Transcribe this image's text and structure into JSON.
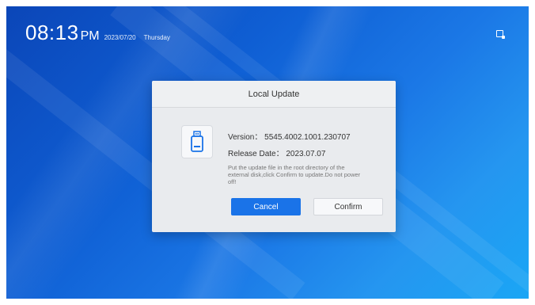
{
  "clock": {
    "time": "08:13",
    "ampm": "PM",
    "date": "2023/07/20",
    "day": "Thursday"
  },
  "corner_icon": "screen-capture-icon",
  "dialog": {
    "title": "Local Update",
    "icon": "usb-drive-icon",
    "version": "Version： 5545.4002.1001.230707",
    "release_date": "Release Date： 2023.07.07",
    "note": "Put the update file in the root directory of the external disk,click Confirm to update.Do not power off!",
    "cancel_label": "Cancel",
    "confirm_label": "Confirm"
  },
  "colors": {
    "primary_button": "#1a73e8",
    "background_start": "#0b46b8",
    "background_end": "#1aa6f5"
  }
}
